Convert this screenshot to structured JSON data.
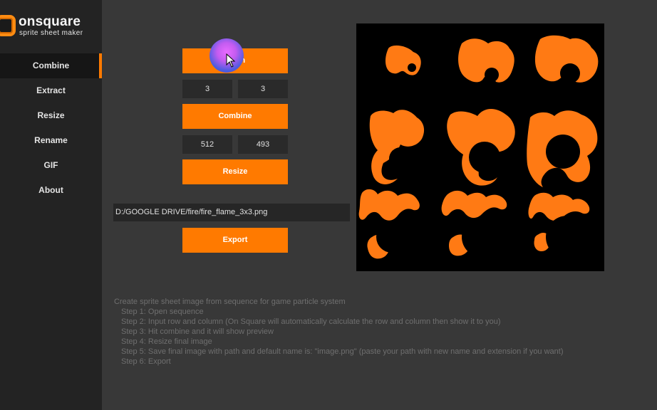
{
  "app": {
    "name": "onsquare",
    "subtitle": "sprite sheet maker"
  },
  "sidebar": {
    "items": [
      {
        "label": "Combine",
        "active": true
      },
      {
        "label": "Extract",
        "active": false
      },
      {
        "label": "Resize",
        "active": false
      },
      {
        "label": "Rename",
        "active": false
      },
      {
        "label": "GIF",
        "active": false
      },
      {
        "label": "About",
        "active": false
      }
    ]
  },
  "controls": {
    "open_label": "Open",
    "rows": "3",
    "columns": "3",
    "combine_label": "Combine",
    "width": "512",
    "height": "493",
    "resize_label": "Resize",
    "path": "D:/GOOGLE DRIVE/fire/fire_flame_3x3.png",
    "export_label": "Export"
  },
  "help": {
    "intro": "Create sprite sheet image from sequence for game particle system",
    "steps": [
      "Step 1: Open sequence",
      "Step 2: Input row and column (On Square will automatically calculate the row and column then show it to you)",
      "Step 3: Hit combine and it will show preview",
      "Step 4: Resize final image",
      "Step 5: Save final image with path and default name is: \"image.png\" (paste your path with new name and extension if you want)",
      "Step 6: Export"
    ]
  },
  "colors": {
    "accent": "#ff7a00",
    "sidebar_bg": "#232323",
    "main_bg": "#383838"
  }
}
